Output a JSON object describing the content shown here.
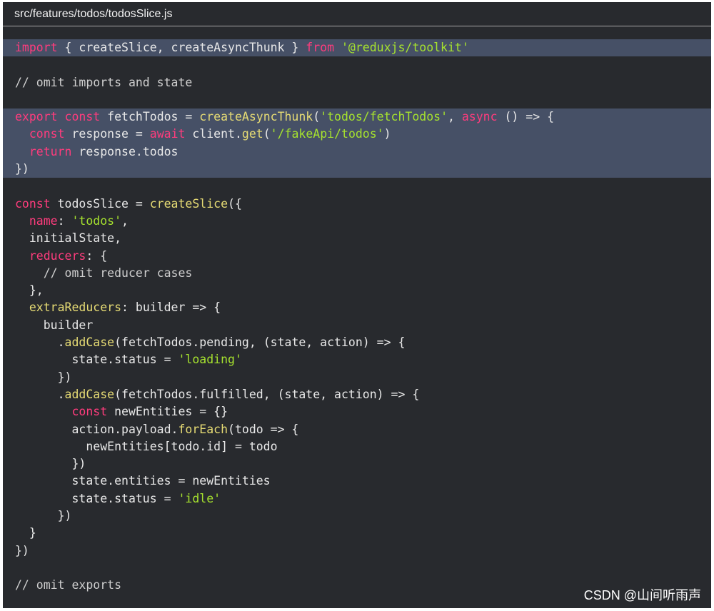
{
  "file": {
    "path": "src/features/todos/todosSlice.js"
  },
  "code": {
    "lines": [
      {
        "hl": true,
        "tokens": [
          {
            "t": "import",
            "c": "kw"
          },
          {
            "t": " { createSlice, createAsyncThunk } "
          },
          {
            "t": "from",
            "c": "kw"
          },
          {
            "t": " "
          },
          {
            "t": "'@reduxjs/toolkit'",
            "c": "str"
          }
        ]
      },
      {
        "hl": false,
        "tokens": []
      },
      {
        "hl": false,
        "tokens": [
          {
            "t": "// omit imports and state",
            "c": "cmt"
          }
        ]
      },
      {
        "hl": false,
        "tokens": []
      },
      {
        "hl": true,
        "tokens": [
          {
            "t": "export",
            "c": "kw"
          },
          {
            "t": " "
          },
          {
            "t": "const",
            "c": "kw"
          },
          {
            "t": " fetchTodos = "
          },
          {
            "t": "createAsyncThunk",
            "c": "fn"
          },
          {
            "t": "("
          },
          {
            "t": "'todos/fetchTodos'",
            "c": "str"
          },
          {
            "t": ", "
          },
          {
            "t": "async",
            "c": "kw"
          },
          {
            "t": " () => {"
          }
        ]
      },
      {
        "hl": true,
        "tokens": [
          {
            "t": "  "
          },
          {
            "t": "const",
            "c": "kw"
          },
          {
            "t": " response = "
          },
          {
            "t": "await",
            "c": "kw"
          },
          {
            "t": " client."
          },
          {
            "t": "get",
            "c": "fn"
          },
          {
            "t": "("
          },
          {
            "t": "'/fakeApi/todos'",
            "c": "str"
          },
          {
            "t": ")"
          }
        ]
      },
      {
        "hl": true,
        "tokens": [
          {
            "t": "  "
          },
          {
            "t": "return",
            "c": "kw"
          },
          {
            "t": " response.todos"
          }
        ]
      },
      {
        "hl": true,
        "tokens": [
          {
            "t": "})"
          }
        ]
      },
      {
        "hl": false,
        "tokens": []
      },
      {
        "hl": false,
        "tokens": [
          {
            "t": "const",
            "c": "kw"
          },
          {
            "t": " todosSlice = "
          },
          {
            "t": "createSlice",
            "c": "fn"
          },
          {
            "t": "({"
          }
        ]
      },
      {
        "hl": false,
        "tokens": [
          {
            "t": "  "
          },
          {
            "t": "name",
            "c": "kw"
          },
          {
            "t": ": "
          },
          {
            "t": "'todos'",
            "c": "str"
          },
          {
            "t": ","
          }
        ]
      },
      {
        "hl": false,
        "tokens": [
          {
            "t": "  initialState,"
          }
        ]
      },
      {
        "hl": false,
        "tokens": [
          {
            "t": "  "
          },
          {
            "t": "reducers",
            "c": "kw"
          },
          {
            "t": ": {"
          }
        ]
      },
      {
        "hl": false,
        "tokens": [
          {
            "t": "    "
          },
          {
            "t": "// omit reducer cases",
            "c": "cmt"
          }
        ]
      },
      {
        "hl": false,
        "tokens": [
          {
            "t": "  },"
          }
        ]
      },
      {
        "hl": false,
        "tokens": [
          {
            "t": "  "
          },
          {
            "t": "extraReducers",
            "c": "fn"
          },
          {
            "t": ": builder => {"
          }
        ]
      },
      {
        "hl": false,
        "tokens": [
          {
            "t": "    builder"
          }
        ]
      },
      {
        "hl": false,
        "tokens": [
          {
            "t": "      ."
          },
          {
            "t": "addCase",
            "c": "fn"
          },
          {
            "t": "(fetchTodos.pending, (state, action) => {"
          }
        ]
      },
      {
        "hl": false,
        "tokens": [
          {
            "t": "        state.status = "
          },
          {
            "t": "'loading'",
            "c": "str"
          }
        ]
      },
      {
        "hl": false,
        "tokens": [
          {
            "t": "      })"
          }
        ]
      },
      {
        "hl": false,
        "tokens": [
          {
            "t": "      ."
          },
          {
            "t": "addCase",
            "c": "fn"
          },
          {
            "t": "(fetchTodos.fulfilled, (state, action) => {"
          }
        ]
      },
      {
        "hl": false,
        "tokens": [
          {
            "t": "        "
          },
          {
            "t": "const",
            "c": "kw"
          },
          {
            "t": " newEntities = {}"
          }
        ]
      },
      {
        "hl": false,
        "tokens": [
          {
            "t": "        action.payload."
          },
          {
            "t": "forEach",
            "c": "fn"
          },
          {
            "t": "(todo => {"
          }
        ]
      },
      {
        "hl": false,
        "tokens": [
          {
            "t": "          newEntities[todo.id] = todo"
          }
        ]
      },
      {
        "hl": false,
        "tokens": [
          {
            "t": "        })"
          }
        ]
      },
      {
        "hl": false,
        "tokens": [
          {
            "t": "        state.entities = newEntities"
          }
        ]
      },
      {
        "hl": false,
        "tokens": [
          {
            "t": "        state.status = "
          },
          {
            "t": "'idle'",
            "c": "str"
          }
        ]
      },
      {
        "hl": false,
        "tokens": [
          {
            "t": "      })"
          }
        ]
      },
      {
        "hl": false,
        "tokens": [
          {
            "t": "  }"
          }
        ]
      },
      {
        "hl": false,
        "tokens": [
          {
            "t": "})"
          }
        ]
      },
      {
        "hl": false,
        "tokens": []
      },
      {
        "hl": false,
        "tokens": [
          {
            "t": "// omit exports",
            "c": "cmt"
          }
        ]
      }
    ]
  },
  "watermark": {
    "text": "CSDN @山间听雨声"
  },
  "colors": {
    "background": "#282a2e",
    "highlight": "#465066",
    "keyword": "#ff3c7d",
    "string": "#a6e22e",
    "function": "#e6db74",
    "text": "#e8e8e8"
  }
}
